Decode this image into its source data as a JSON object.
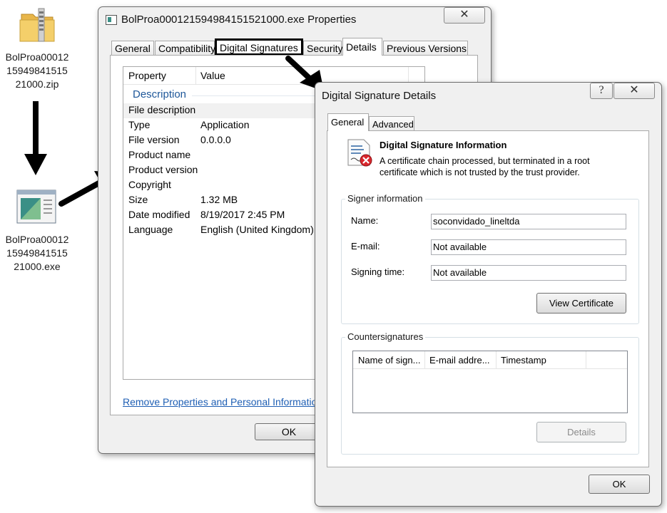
{
  "desktop": {
    "zip_file": {
      "label": "BolProa00012\n15949841515\n21000.zip",
      "icon": "zip-folder-icon"
    },
    "exe_file": {
      "label": "BolProa00012\n15949841515\n21000.exe",
      "icon": "application-icon"
    }
  },
  "properties_window": {
    "title": "BolProa000121594984151521000.exe Properties",
    "tabs": [
      "General",
      "Compatibility",
      "Digital Signatures",
      "Security",
      "Details",
      "Previous Versions"
    ],
    "active_tab": "Details",
    "highlighted_tab": "Digital Signatures",
    "columns": {
      "property": "Property",
      "value": "Value"
    },
    "section": "Description",
    "rows": [
      {
        "property": "File description",
        "value": ""
      },
      {
        "property": "Type",
        "value": "Application"
      },
      {
        "property": "File version",
        "value": "0.0.0.0"
      },
      {
        "property": "Product name",
        "value": ""
      },
      {
        "property": "Product version",
        "value": ""
      },
      {
        "property": "Copyright",
        "value": ""
      },
      {
        "property": "Size",
        "value": "1.32 MB"
      },
      {
        "property": "Date modified",
        "value": "8/19/2017 2:45 PM"
      },
      {
        "property": "Language",
        "value": "English (United Kingdom)"
      }
    ],
    "remove_link": "Remove Properties and Personal Information",
    "ok_label": "OK",
    "close_glyph": "✕"
  },
  "signature_window": {
    "title": "Digital Signature Details",
    "help_glyph": "?",
    "close_glyph": "✕",
    "tabs": [
      "General",
      "Advanced"
    ],
    "info_title": "Digital Signature Information",
    "info_text": "A certificate chain processed, but terminated in a root certificate which is not trusted by the trust provider.",
    "signer_group": "Signer information",
    "name_label": "Name:",
    "name_value": "soconvidado_lineltda",
    "email_label": "E-mail:",
    "email_value": "Not available",
    "signing_time_label": "Signing time:",
    "signing_time_value": "Not available",
    "view_certificate": "View Certificate",
    "counter_group": "Countersignatures",
    "counter_columns": [
      "Name of sign...",
      "E-mail addre...",
      "Timestamp"
    ],
    "details_label": "Details",
    "ok_label": "OK"
  },
  "colors": {
    "link": "#1f5fb4",
    "section": "#1e5799",
    "highlight_border": "#000000"
  }
}
